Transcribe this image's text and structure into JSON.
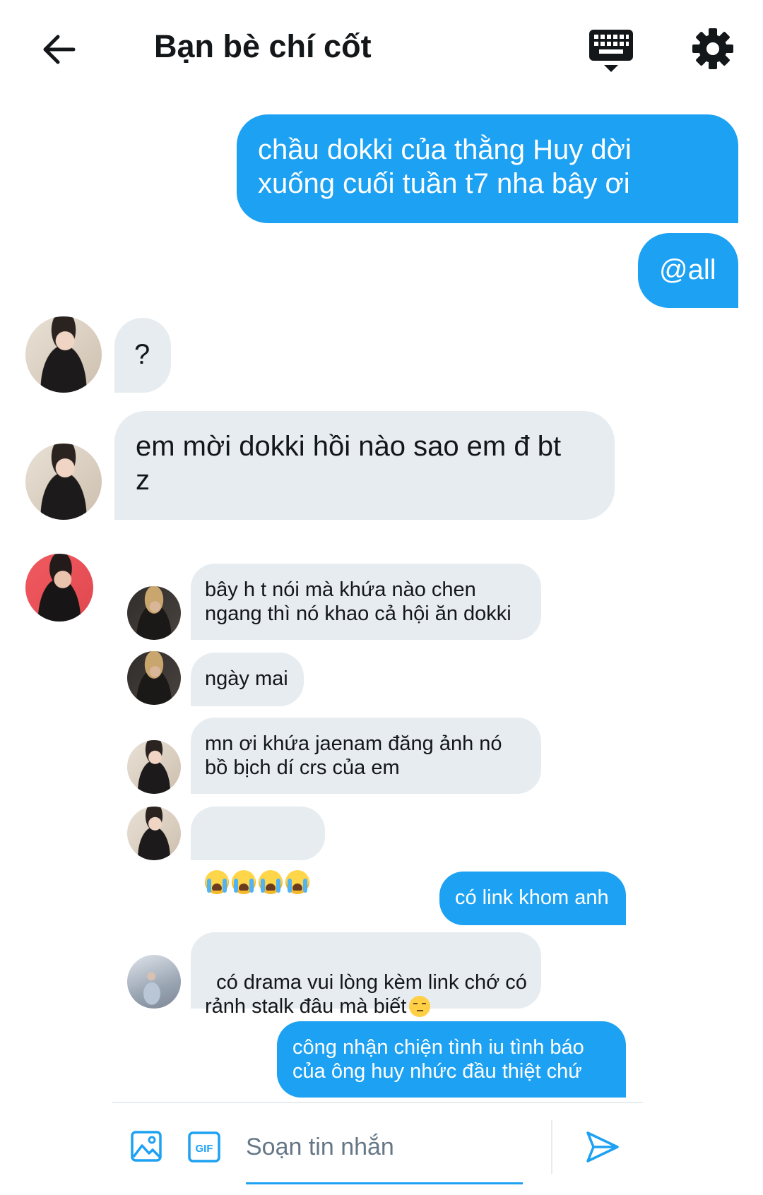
{
  "header": {
    "title": "Bạn bè chí cốt"
  },
  "icons": {
    "back": "arrow-left-icon",
    "keyboard": "keyboard-icon",
    "settings": "gear-icon",
    "image": "image-icon",
    "gif": "gif-icon",
    "send": "send-icon"
  },
  "composer": {
    "placeholder": "Soạn tin nhắn",
    "gif_label": "GIF"
  },
  "messages": [
    {
      "direction": "out",
      "text": "chầu dokki của thằng Huy dời\nxuống cuối tuần t7 nha bây ơi"
    },
    {
      "direction": "out",
      "text": "@all"
    },
    {
      "direction": "in",
      "text": "?"
    },
    {
      "direction": "in",
      "text": "em mời dokki hồi nào sao em đ bt\nz"
    },
    {
      "direction": "in",
      "text": "bây h t nói mà khứa nào chen\nngang thì nó khao cả hội ăn dokki"
    },
    {
      "direction": "in",
      "text": "ngày mai"
    },
    {
      "direction": "in",
      "text": "mn ơi khứa jaenam đăng ảnh nó\nbồ bịch dí crs của em"
    },
    {
      "direction": "in",
      "text": "",
      "emoji": [
        "crying-face",
        "crying-face",
        "crying-face",
        "crying-face"
      ]
    },
    {
      "direction": "out",
      "text": "có link khom anh"
    },
    {
      "direction": "in",
      "text": "có drama vui lòng kèm link chớ có\nrảnh stalk đâu mà biết",
      "emoji": [
        "pensive-face"
      ]
    },
    {
      "direction": "out",
      "text": "công nhận chiện tình iu tình báo\ncủa ông huy nhức đầu thiệt chứ"
    }
  ],
  "colors": {
    "outgoing_bubble": "#1da1f2",
    "incoming_bubble": "#e6ecf0",
    "text": "#14171a",
    "accent": "#1da1f2"
  }
}
